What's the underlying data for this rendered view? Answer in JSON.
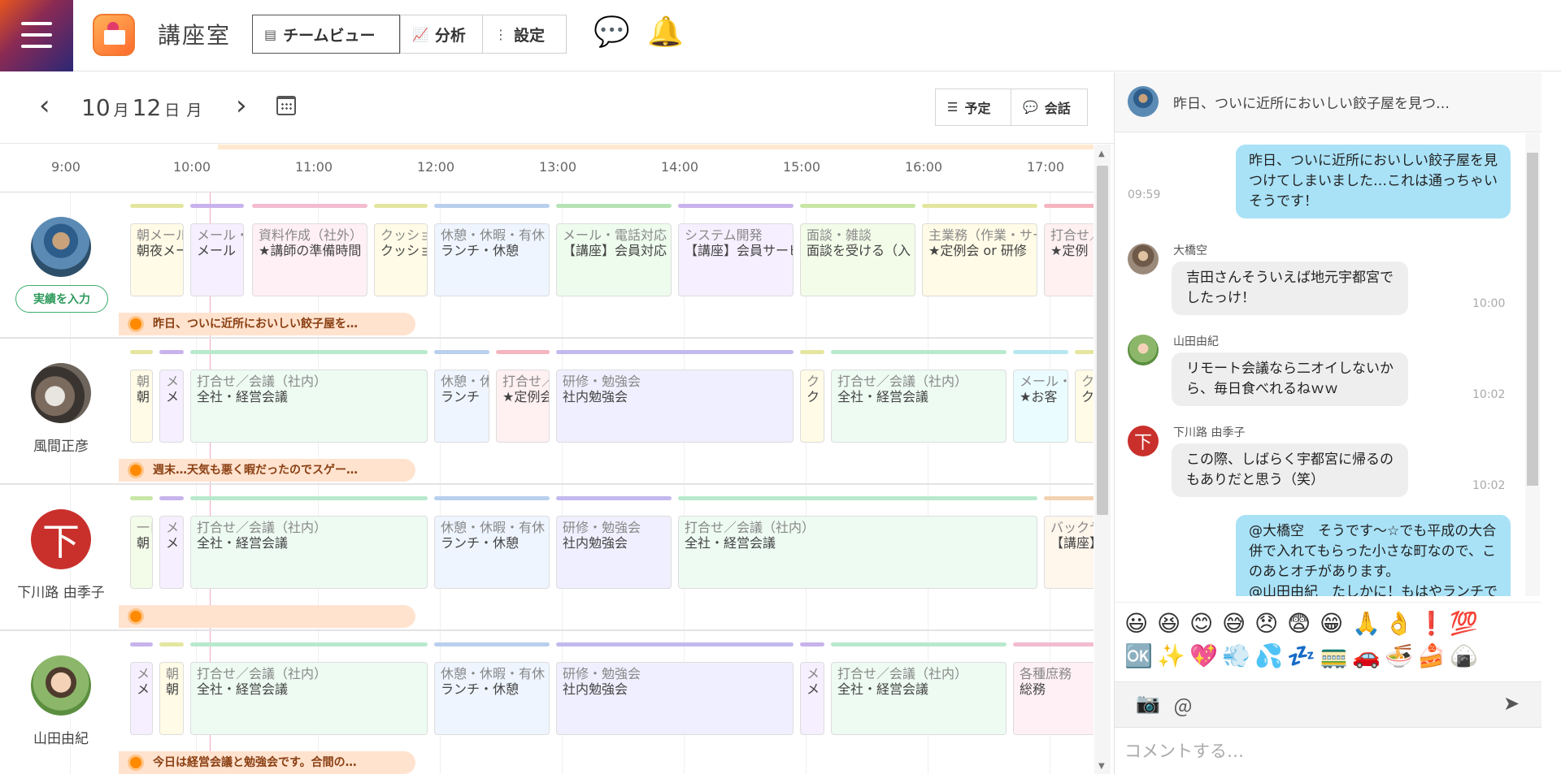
{
  "app": {
    "title": "講座室",
    "tabs": [
      {
        "label": "チームビュー",
        "icon": "team-view-icon"
      },
      {
        "label": "分析",
        "icon": "chart-icon"
      },
      {
        "label": "設定",
        "icon": "settings-icon"
      }
    ]
  },
  "date": {
    "month": "10",
    "month_unit": "月",
    "day": "12",
    "day_unit": "日",
    "weekday": "月"
  },
  "view_toggle": {
    "schedule": "予定",
    "conversation": "会話"
  },
  "times": [
    "9:00",
    "10:00",
    "11:00",
    "12:00",
    "13:00",
    "14:00",
    "15:00",
    "16:00",
    "17:00"
  ],
  "users": [
    {
      "name": "",
      "button": "実績を入力",
      "comment": "昨日、ついに近所においしい餃子屋を…",
      "blocks": [
        {
          "l1": "朝メール",
          "l2": "朝夜メール",
          "bg": "#fffbe6",
          "bar": "#e4e6a0"
        },
        {
          "l1": "メール・",
          "l2": "メール",
          "bg": "#f5efff",
          "bar": "#c8b3ec"
        },
        {
          "l1": "資料作成（社外）",
          "l2": "★講師の準備時間",
          "bg": "#fff0f5",
          "bar": "#f3bcd0"
        },
        {
          "l1": "クッショ",
          "l2": "クッション",
          "bg": "#fffbe6",
          "bar": "#e4e6a0"
        },
        {
          "l1": "休憩・休暇・有休",
          "l2": "ランチ・休憩",
          "bg": "#eef5ff",
          "bar": "#b9cfee"
        },
        {
          "l1": "メール・電話対応",
          "l2": "【講座】会員対応",
          "bg": "#eefcee",
          "bar": "#b6e3b6"
        },
        {
          "l1": "システム開発",
          "l2": "【講座】会員サービス",
          "bg": "#f6efff",
          "bar": "#c8b3ec"
        },
        {
          "l1": "面談・雑談",
          "l2": "面談を受ける（入",
          "bg": "#f3fbe9",
          "bar": "#c9e6a6"
        },
        {
          "l1": "主業務（作業・サービス",
          "l2": "★定例会 or 研修",
          "bg": "#fffbe6",
          "bar": "#e4e6a0"
        },
        {
          "l1": "打合せ／",
          "l2": "★定例",
          "bg": "#fff0f2",
          "bar": "#f5b5bf"
        }
      ]
    },
    {
      "name": "風間正彦",
      "comment": "週末…天気も悪く暇だったのでスゲー…",
      "blocks": [
        {
          "l1": "朝",
          "l2": "朝",
          "bg": "#fffbe6",
          "bar": "#e4e6a0"
        },
        {
          "l1": "メ",
          "l2": "メ",
          "bg": "#f5efff",
          "bar": "#c8b3ec"
        },
        {
          "l1": "打合せ／会議（社内）",
          "l2": "全社・経営会議",
          "bg": "#edfbf3",
          "bar": "#b9e9cd"
        },
        {
          "l1": "休憩・休",
          "l2": "ランチ",
          "bg": "#eef5ff",
          "bar": "#b9cfee"
        },
        {
          "l1": "打合せ／",
          "l2": "★定例会",
          "bg": "#fff0f2",
          "bar": "#f5b5bf"
        },
        {
          "l1": "研修・勉強会",
          "l2": "社内勉強会",
          "bg": "#f0efff",
          "bar": "#c3b9ee"
        },
        {
          "l1": "ク",
          "l2": "ク",
          "bg": "#fffbe6",
          "bar": "#e4e6a0"
        },
        {
          "l1": "打合せ／会議（社内）",
          "l2": "全社・経営会議",
          "bg": "#edfbf3",
          "bar": "#b9e9cd"
        },
        {
          "l1": "メール・",
          "l2": "★お客",
          "bg": "#eafcff",
          "bar": "#b6e7f0"
        },
        {
          "l1": "ク",
          "l2": "ク",
          "bg": "#fffbe6",
          "bar": "#e4e6a0"
        }
      ]
    },
    {
      "name": "下川路 由季子",
      "initial": "下",
      "comment": "",
      "blocks": [
        {
          "l1": "一日",
          "l2": "朝",
          "bg": "#f3fbe9",
          "bar": "#c9e6a6"
        },
        {
          "l1": "メ",
          "l2": "メ",
          "bg": "#f5efff",
          "bar": "#c8b3ec"
        },
        {
          "l1": "打合せ／会議（社内）",
          "l2": "全社・経営会議",
          "bg": "#edfbf3",
          "bar": "#b9e9cd"
        },
        {
          "l1": "休憩・休暇・有休",
          "l2": "ランチ・休憩",
          "bg": "#eef5ff",
          "bar": "#b9cfee"
        },
        {
          "l1": "研修・勉強会",
          "l2": "社内勉強会",
          "bg": "#f0efff",
          "bar": "#c3b9ee"
        },
        {
          "l1": "打合せ／会議（社内）",
          "l2": "全社・経営会議",
          "bg": "#edfbf3",
          "bar": "#b9e9cd"
        },
        {
          "l1": "バックヤ",
          "l2": "【講座】",
          "bg": "#fff6ec",
          "bar": "#f3d2b0"
        }
      ]
    },
    {
      "name": "山田由紀",
      "comment": "今日は経営会議と勉強会です。合間の…",
      "blocks": [
        {
          "l1": "メ",
          "l2": "メ",
          "bg": "#f5efff",
          "bar": "#c8b3ec"
        },
        {
          "l1": "朝",
          "l2": "朝",
          "bg": "#fffbe6",
          "bar": "#e4e6a0"
        },
        {
          "l1": "打合せ／会議（社内）",
          "l2": "全社・経営会議",
          "bg": "#edfbf3",
          "bar": "#b9e9cd"
        },
        {
          "l1": "休憩・休暇・有休",
          "l2": "ランチ・休憩",
          "bg": "#eef5ff",
          "bar": "#b9cfee"
        },
        {
          "l1": "研修・勉強会",
          "l2": "社内勉強会",
          "bg": "#f0efff",
          "bar": "#c3b9ee"
        },
        {
          "l1": "メ",
          "l2": "メ",
          "bg": "#f5efff",
          "bar": "#c8b3ec"
        },
        {
          "l1": "打合せ／会議（社内）",
          "l2": "全社・経営会議",
          "bg": "#edfbf3",
          "bar": "#b9e9cd"
        },
        {
          "l1": "各種庶務",
          "l2": "総務",
          "bg": "#fff0f5",
          "bar": "#f3bcd0"
        }
      ]
    }
  ],
  "panel": {
    "header": "昨日、ついに近所においしい餃子屋を見つ…",
    "messages": [
      {
        "me": true,
        "lines": [
          "昨日、ついに近所においしい餃子屋を見",
          "つけてしまいました…これは通っちゃい",
          "そうです！"
        ],
        "time": "09:59"
      },
      {
        "sender": "大橋空",
        "lines": [
          "吉田さんそういえば地元宇都宮で",
          "したっけ！"
        ],
        "time": "10:00"
      },
      {
        "sender": "山田由紀",
        "lines": [
          "リモート会議なら二オイしないか",
          "ら、毎日食べれるねｗｗ"
        ],
        "time": "10:02"
      },
      {
        "sender": "下川路 由季子",
        "initial": "下",
        "lines": [
          "この際、しばらく宇都宮に帰るの",
          "もありだと思う（笑）"
        ],
        "time": "10:02"
      },
      {
        "me": true,
        "lines": [
          "@大橋空　そうです〜☆でも平成の大合",
          "併で入れてもらった小さな町なので、こ",
          "のあとオチがあります。",
          "@山田由紀　たしかに！もはやランチで"
        ]
      }
    ],
    "emojis_row1": [
      "😃",
      "😆",
      "😊",
      "😅",
      "😞",
      "😨",
      "😁",
      "🙏",
      "👌",
      "❗",
      "💯"
    ],
    "emojis_row2": [
      "🆗",
      "✨",
      "💖",
      "💨",
      "💦",
      "💤",
      "🚃",
      "🚗",
      "🍜",
      "🍰",
      "🍙"
    ],
    "input_placeholder": "コメントする…"
  }
}
